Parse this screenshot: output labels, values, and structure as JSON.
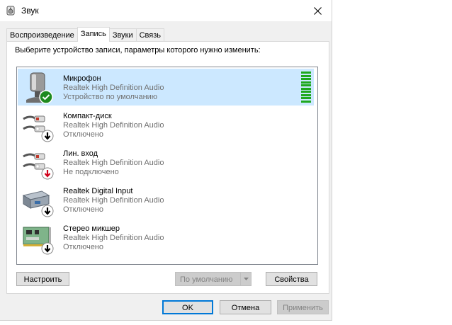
{
  "window": {
    "title": "Звук",
    "icon": "speaker-icon"
  },
  "tabs": [
    {
      "label": "Воспроизведение",
      "active": false
    },
    {
      "label": "Запись",
      "active": true
    },
    {
      "label": "Звуки",
      "active": false
    },
    {
      "label": "Связь",
      "active": false
    }
  ],
  "instruction": "Выберите устройство записи, параметры которого нужно изменить:",
  "devices": [
    {
      "name": "Микрофон",
      "driver": "Realtek High Definition Audio",
      "status": "Устройство по умолчанию",
      "selected": true,
      "icon": "microphone-icon",
      "badge": "default-check-icon",
      "level_fraction": 1.0
    },
    {
      "name": "Компакт-диск",
      "driver": "Realtek High Definition Audio",
      "status": "Отключено",
      "selected": false,
      "icon": "rca-cable-icon",
      "badge": "disabled-arrow-icon"
    },
    {
      "name": "Лин. вход",
      "driver": "Realtek High Definition Audio",
      "status": "Не подключено",
      "selected": false,
      "icon": "rca-cable-icon",
      "badge": "unplugged-arrow-icon"
    },
    {
      "name": "Realtek Digital Input",
      "driver": "Realtek High Definition Audio",
      "status": "Отключено",
      "selected": false,
      "icon": "digital-input-icon",
      "badge": "disabled-arrow-icon"
    },
    {
      "name": "Стерео микшер",
      "driver": "Realtek High Definition Audio",
      "status": "Отключено",
      "selected": false,
      "icon": "sound-card-icon",
      "badge": "disabled-arrow-icon"
    }
  ],
  "buttons": {
    "configure": "Настроить",
    "set_default": "По умолчанию",
    "properties": "Свойства",
    "ok": "OK",
    "cancel": "Отмена",
    "apply": "Применить"
  },
  "colors": {
    "selection": "#cce8ff",
    "level_meter": "#1ea81e",
    "focus_border": "#0078d7"
  }
}
